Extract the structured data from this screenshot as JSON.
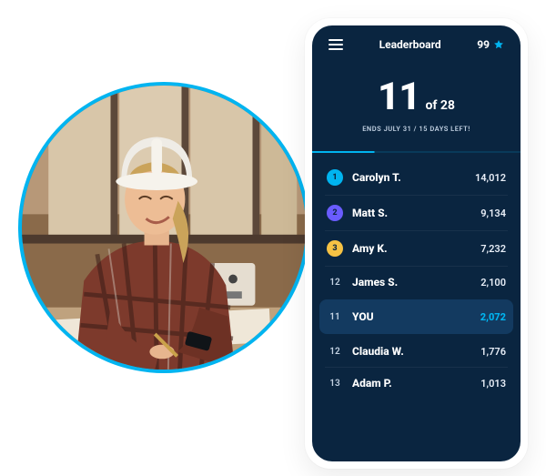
{
  "avatar": {
    "description": "woman-in-hardhat-photo",
    "ring_color": "#00b4f0"
  },
  "topbar": {
    "title": "Leaderboard",
    "points": "99"
  },
  "hero": {
    "rank": "11",
    "of_label": "of 28",
    "ends_text": "ENDS JULY 31 / 15 DAYS LEFT!"
  },
  "rows": [
    {
      "rank": "1",
      "name": "Carolyn T.",
      "score": "14,012",
      "badge_color": "#00b4f0",
      "is_badge": true,
      "is_you": false
    },
    {
      "rank": "2",
      "name": "Matt S.",
      "score": "9,134",
      "badge_color": "#6a5cff",
      "is_badge": true,
      "is_you": false
    },
    {
      "rank": "3",
      "name": "Amy K.",
      "score": "7,232",
      "badge_color": "#f6c244",
      "is_badge": true,
      "is_you": false
    },
    {
      "rank": "12",
      "name": "James S.",
      "score": "2,100",
      "badge_color": "",
      "is_badge": false,
      "is_you": false
    },
    {
      "rank": "11",
      "name": "YOU",
      "score": "2,072",
      "badge_color": "",
      "is_badge": false,
      "is_you": true
    },
    {
      "rank": "12",
      "name": "Claudia W.",
      "score": "1,776",
      "badge_color": "",
      "is_badge": false,
      "is_you": false
    },
    {
      "rank": "13",
      "name": "Adam P.",
      "score": "1,013",
      "badge_color": "",
      "is_badge": false,
      "is_you": false
    }
  ],
  "colors": {
    "screen_bg": "#0a2540",
    "accent": "#00b4f0",
    "you_row_bg": "#133a60"
  }
}
